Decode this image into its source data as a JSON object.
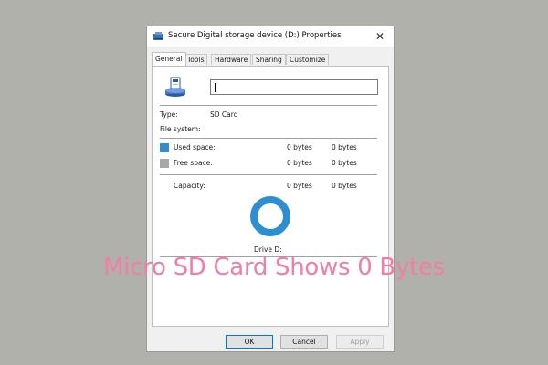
{
  "dialog": {
    "title": "Secure Digital storage device (D:) Properties",
    "close_glyph": "✕",
    "tabs": [
      {
        "label": "General",
        "active": true
      },
      {
        "label": "Tools"
      },
      {
        "label": "Hardware"
      },
      {
        "label": "Sharing"
      },
      {
        "label": "Customize"
      }
    ],
    "general": {
      "name_value": "",
      "type_label": "Type:",
      "type_value": "SD Card",
      "fs_label": "File system:",
      "fs_value": "",
      "used": {
        "label": "Used space:",
        "bytes": "0 bytes",
        "short": "0 bytes",
        "color": "#2e8fd0"
      },
      "free": {
        "label": "Free space:",
        "bytes": "0 bytes",
        "short": "0 bytes",
        "color": "#a8a8a8"
      },
      "capacity": {
        "label": "Capacity:",
        "bytes": "0 bytes",
        "short": "0 bytes"
      },
      "drive_label": "Drive D:",
      "ring_color": "#2e8fd0"
    },
    "buttons": {
      "ok": "OK",
      "cancel": "Cancel",
      "apply": "Apply"
    }
  },
  "overlay_caption": "Micro SD Card Shows 0 Bytes"
}
